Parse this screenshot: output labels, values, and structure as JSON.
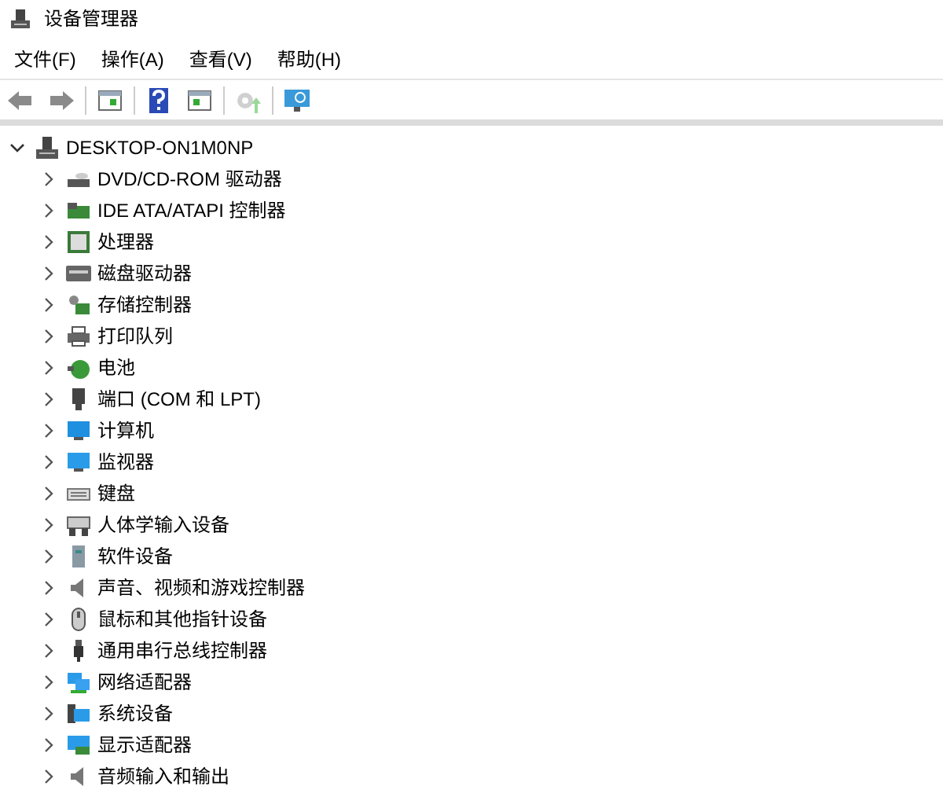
{
  "window": {
    "title": "设备管理器"
  },
  "menu": [
    {
      "label": "文件(F)"
    },
    {
      "label": "操作(A)"
    },
    {
      "label": "查看(V)"
    },
    {
      "label": "帮助(H)"
    }
  ],
  "toolbar": [
    {
      "kind": "back",
      "disabled": false
    },
    {
      "kind": "forward",
      "disabled": false
    },
    {
      "kind": "separator"
    },
    {
      "kind": "properties",
      "disabled": false
    },
    {
      "kind": "separator"
    },
    {
      "kind": "help",
      "disabled": false
    },
    {
      "kind": "view",
      "disabled": false
    },
    {
      "kind": "separator"
    },
    {
      "kind": "update",
      "disabled": true
    },
    {
      "kind": "separator"
    },
    {
      "kind": "scan",
      "disabled": false
    }
  ],
  "tree": [
    {
      "label": "DESKTOP-ON1M0NP",
      "expanded": true,
      "children": [
        {
          "label": "DVD/CD-ROM 驱动器",
          "expanded": false
        },
        {
          "label": "IDE ATA/ATAPI 控制器",
          "expanded": false
        },
        {
          "label": "处理器",
          "expanded": false
        },
        {
          "label": "磁盘驱动器",
          "expanded": false
        },
        {
          "label": "存储控制器",
          "expanded": false
        },
        {
          "label": "打印队列",
          "expanded": false
        },
        {
          "label": "电池",
          "expanded": false
        },
        {
          "label": "端口 (COM 和 LPT)",
          "expanded": false
        },
        {
          "label": "计算机",
          "expanded": false
        },
        {
          "label": "监视器",
          "expanded": false
        },
        {
          "label": "键盘",
          "expanded": false
        },
        {
          "label": "人体学输入设备",
          "expanded": false
        },
        {
          "label": "软件设备",
          "expanded": false
        },
        {
          "label": "声音、视频和游戏控制器",
          "expanded": false
        },
        {
          "label": "鼠标和其他指针设备",
          "expanded": false
        },
        {
          "label": "通用串行总线控制器",
          "expanded": false
        },
        {
          "label": "网络适配器",
          "expanded": false
        },
        {
          "label": "系统设备",
          "expanded": false
        },
        {
          "label": "显示适配器",
          "expanded": false
        },
        {
          "label": "音频输入和输出",
          "expanded": false
        }
      ]
    }
  ]
}
